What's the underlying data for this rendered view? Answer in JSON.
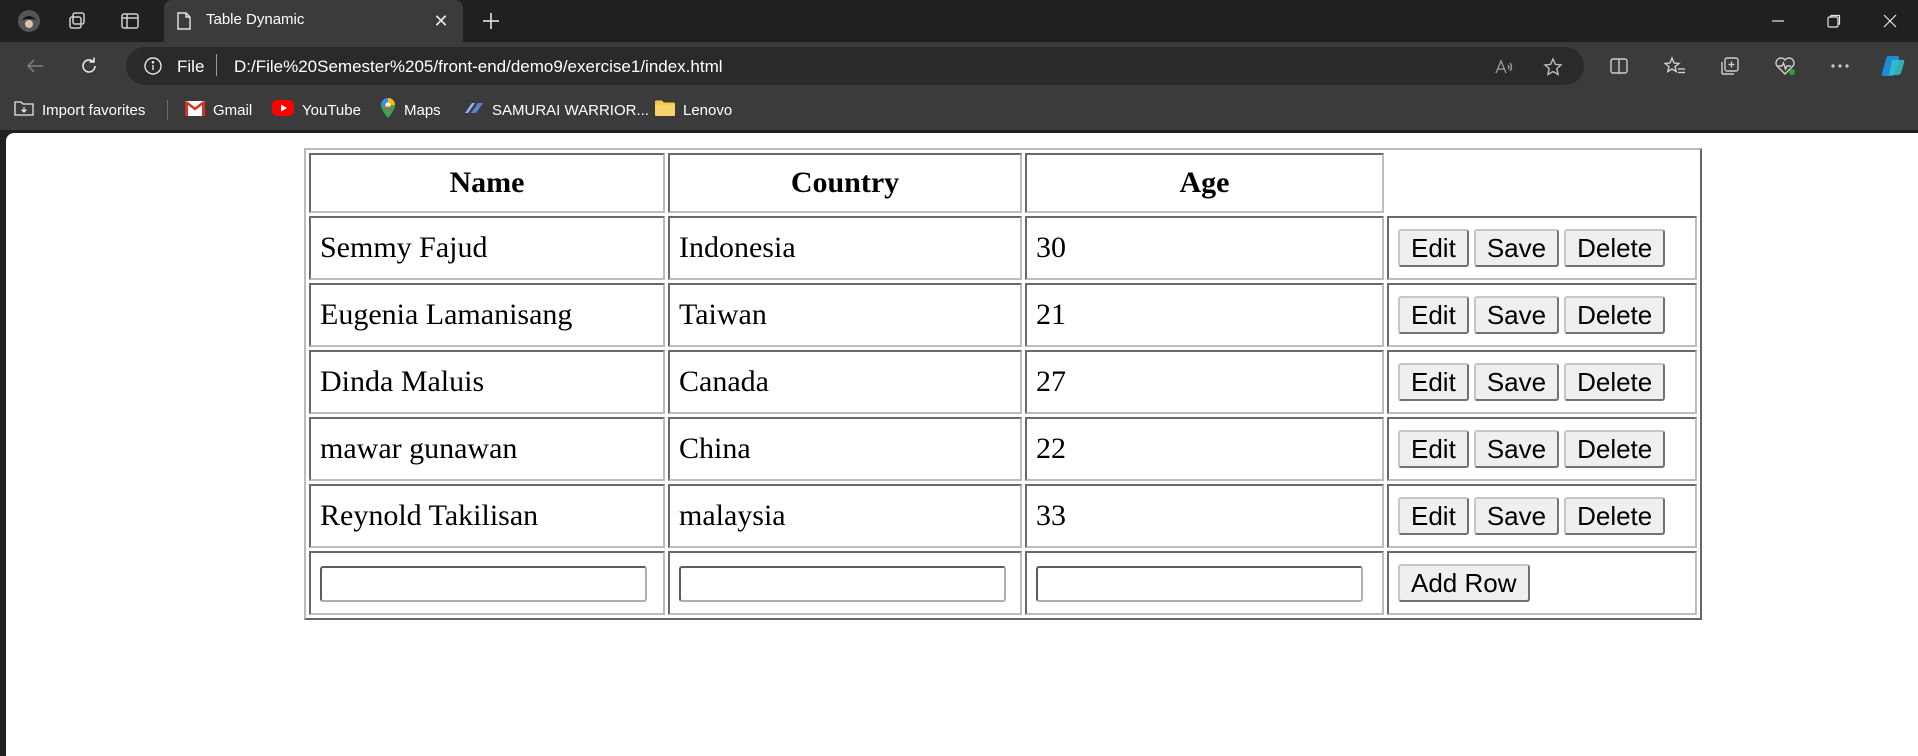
{
  "browser": {
    "tab_title": "Table Dynamic",
    "url_scheme": "File",
    "url": "D:/File%20Semester%205/front-end/demo9/exercise1/index.html",
    "favorites": [
      {
        "label": "Import favorites",
        "icon": "import-icon"
      },
      {
        "label": "Gmail",
        "icon": "gmail-icon"
      },
      {
        "label": "YouTube",
        "icon": "youtube-icon"
      },
      {
        "label": "Maps",
        "icon": "maps-icon"
      },
      {
        "label": "SAMURAI WARRIOR...",
        "icon": "samurai-icon"
      },
      {
        "label": "Lenovo",
        "icon": "folder-icon"
      }
    ]
  },
  "table": {
    "headers": {
      "name": "Name",
      "country": "Country",
      "age": "Age"
    },
    "rows": [
      {
        "name": "Semmy Fajud",
        "country": "Indonesia",
        "age": "30"
      },
      {
        "name": "Eugenia Lamanisang",
        "country": "Taiwan",
        "age": "21"
      },
      {
        "name": "Dinda Maluis",
        "country": "Canada",
        "age": "27"
      },
      {
        "name": "mawar gunawan",
        "country": "China",
        "age": "22"
      },
      {
        "name": "Reynold Takilisan",
        "country": "malaysia",
        "age": "33"
      }
    ],
    "actions": {
      "edit": "Edit",
      "save": "Save",
      "delete": "Delete"
    },
    "new_row": {
      "name_value": "",
      "country_value": "",
      "age_value": "",
      "add_label": "Add Row"
    }
  },
  "colors": {
    "chrome_dark": "#202020",
    "chrome": "#3b3b3b",
    "page": "#ffffff"
  }
}
